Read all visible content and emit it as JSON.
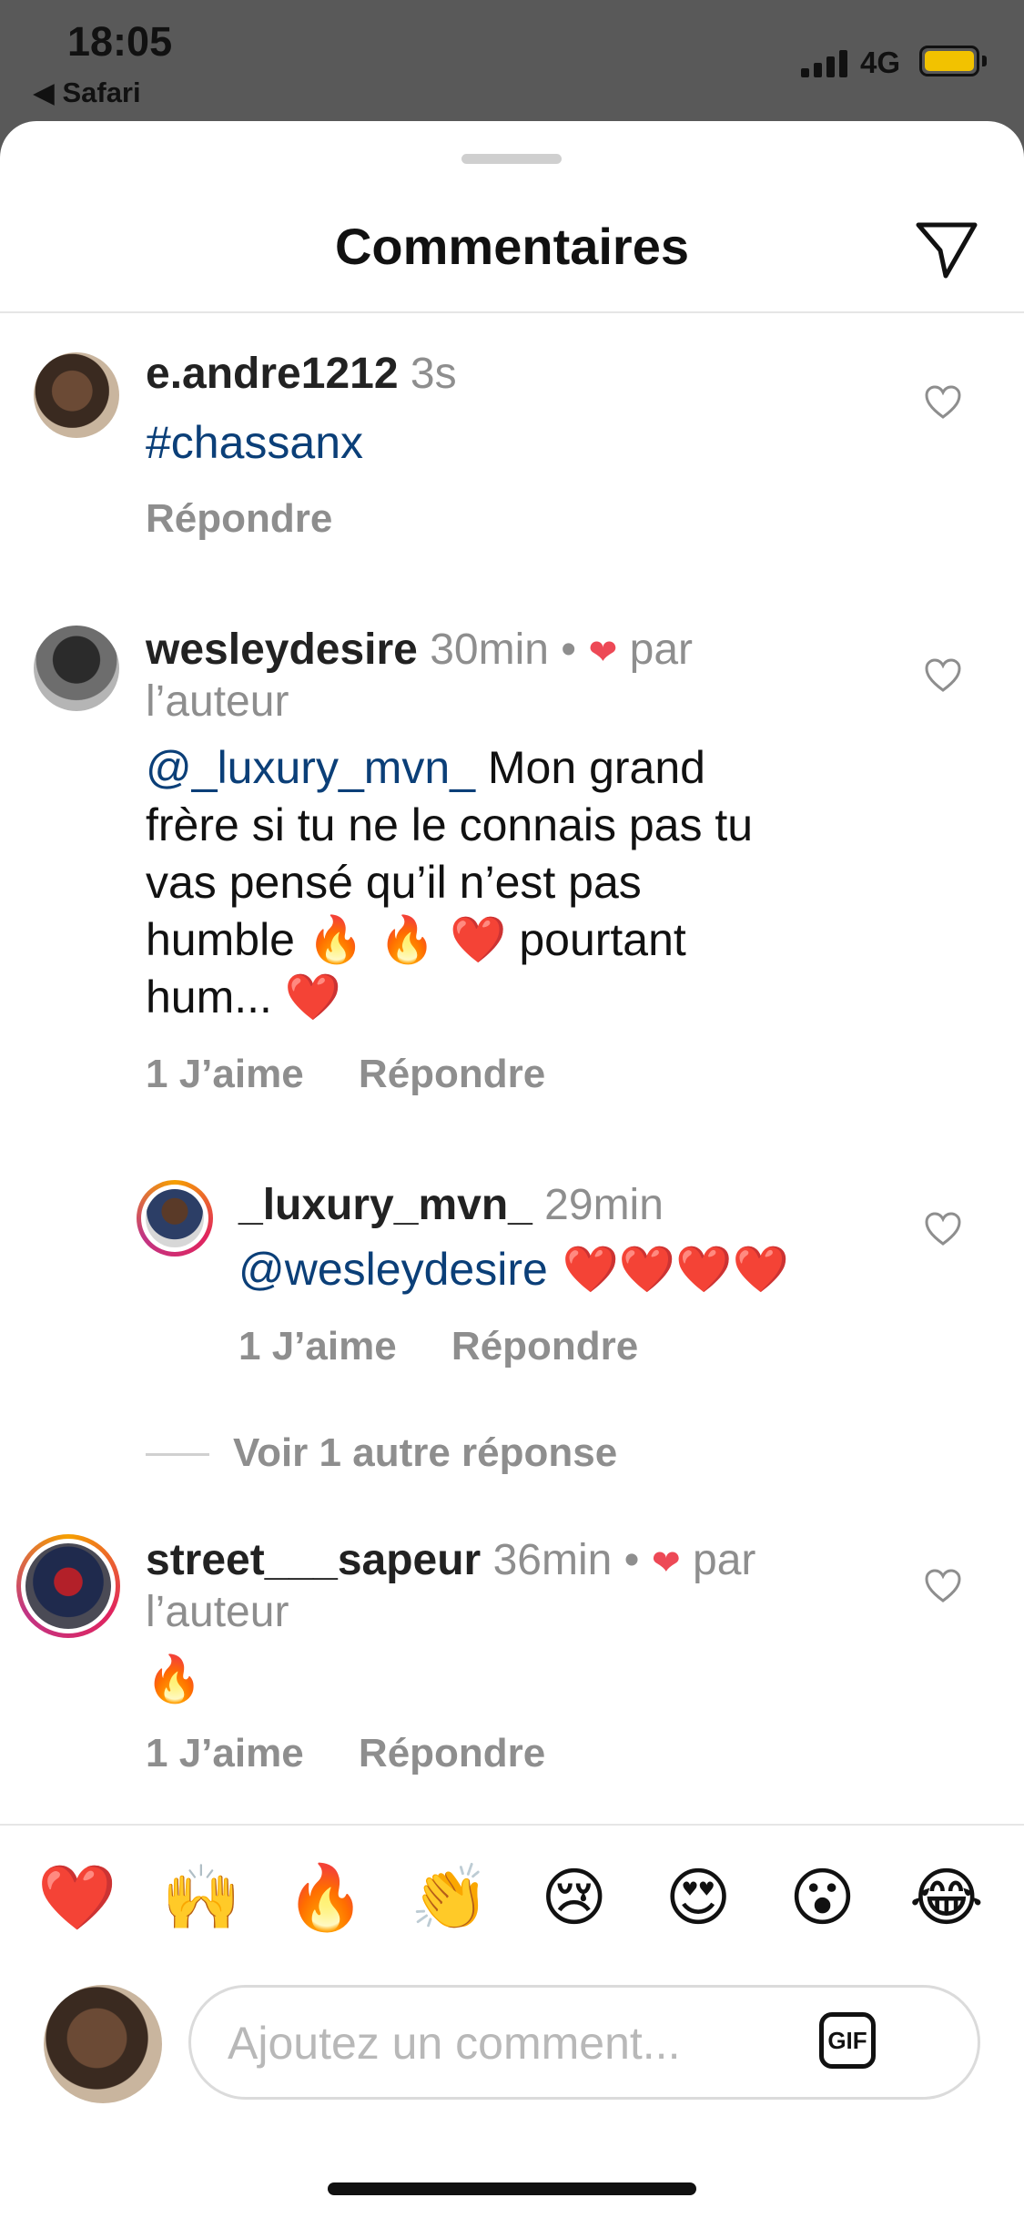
{
  "status_bar": {
    "time": "18:05",
    "back_label": "◀ Safari",
    "network": "4G",
    "battery_color": "#f2c200"
  },
  "header": {
    "title": "Commentaires",
    "send_icon": "paper-plane-icon"
  },
  "comments": [
    {
      "username": "e.andre1212",
      "time": "3s",
      "body": "#chassanx",
      "reply_label": "Répondre"
    },
    {
      "username": "wesleydesire",
      "time": "30min",
      "dot": "•",
      "liked_by_author_heart": "❤",
      "liked_by_author_line1": "par",
      "liked_by_author_line2": "l’auteur",
      "mention": "@_luxury_mvn_",
      "body_line1_rest": " Mon grand",
      "body_line2": "frère si tu  ne le connais pas tu",
      "body_line3": "vas pensé qu’il n’est pas",
      "body_line4_a": "humble ",
      "body_line4_emoji": "🔥 🔥 ❤️",
      "body_line4_b": " pourtant",
      "body_line5_a": "hum... ",
      "body_line5_emoji": "❤️",
      "likes_label": "1 J’aime",
      "reply_label": "Répondre"
    },
    {
      "username": "_luxury_mvn_",
      "time": "29min",
      "mention": "@wesleydesire",
      "emoji": " ❤️❤️❤️❤️",
      "likes_label": "1 J’aime",
      "reply_label": "Répondre"
    },
    {
      "username": "street___sapeur",
      "time": "36min",
      "dot": "•",
      "liked_by_author_heart": "❤",
      "liked_by_author_line1": "par",
      "liked_by_author_line2": "l’auteur",
      "emoji": "🔥",
      "likes_label": "1 J’aime",
      "reply_label": "Répondre"
    }
  ],
  "view_more_replies": "Voir 1 autre réponse",
  "reactions": [
    "❤️",
    "🙌",
    "🔥",
    "👏",
    "😢",
    "😍",
    "😮",
    "😂"
  ],
  "composer": {
    "placeholder": "Ajoutez un comment...",
    "gif_label": "GIF"
  }
}
